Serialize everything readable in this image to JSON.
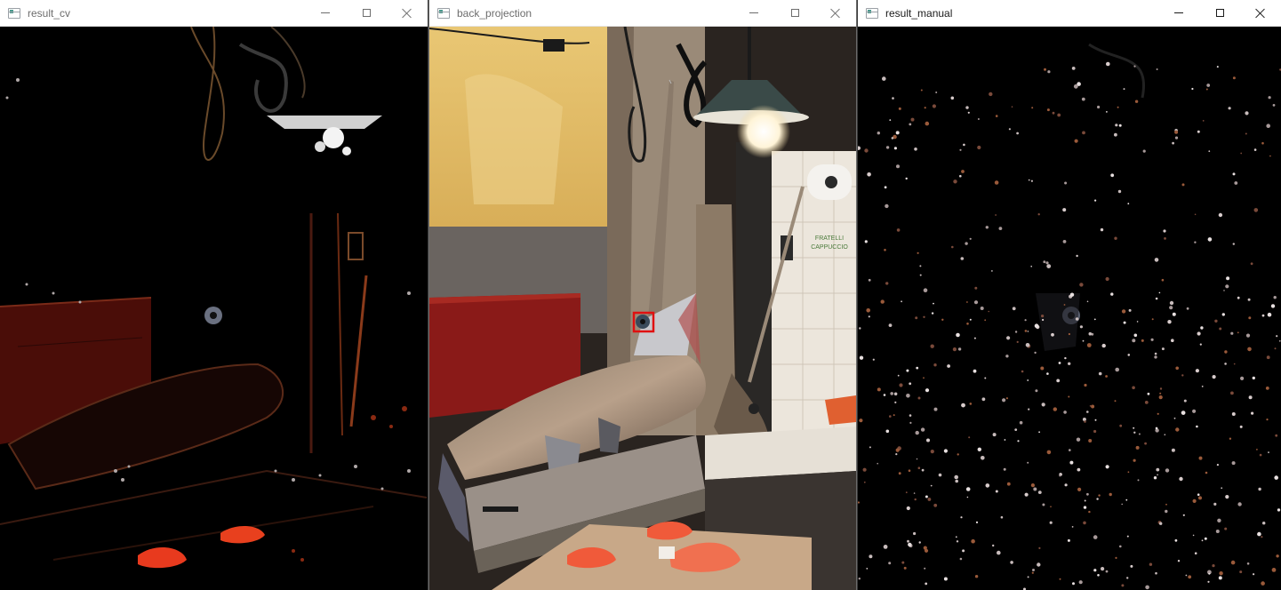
{
  "windows": [
    {
      "title": "result_cv",
      "active": false,
      "controls": {
        "minimize": "minimize-icon",
        "maximize": "maximize-icon",
        "close": "close-icon"
      }
    },
    {
      "title": "back_projection",
      "active": false,
      "controls": {
        "minimize": "minimize-icon",
        "maximize": "maximize-icon",
        "close": "close-icon"
      }
    },
    {
      "title": "result_manual",
      "active": true,
      "controls": {
        "minimize": "minimize-icon",
        "maximize": "maximize-icon",
        "close": "close-icon"
      }
    }
  ],
  "colors": {
    "titlebar_bg": "#ffffff",
    "inactive_title": "#6d6d6d",
    "active_title": "#1a1a1a",
    "roi_box": "#e01010",
    "wall_yellow": "#e8c46a",
    "salmon": "#f05a3a"
  },
  "images": {
    "result_cv": "masked-photo-dark-red-edges",
    "back_projection": "fish-market-photo-with-red-roi-box",
    "result_manual": "sparse-speckle-mask"
  }
}
